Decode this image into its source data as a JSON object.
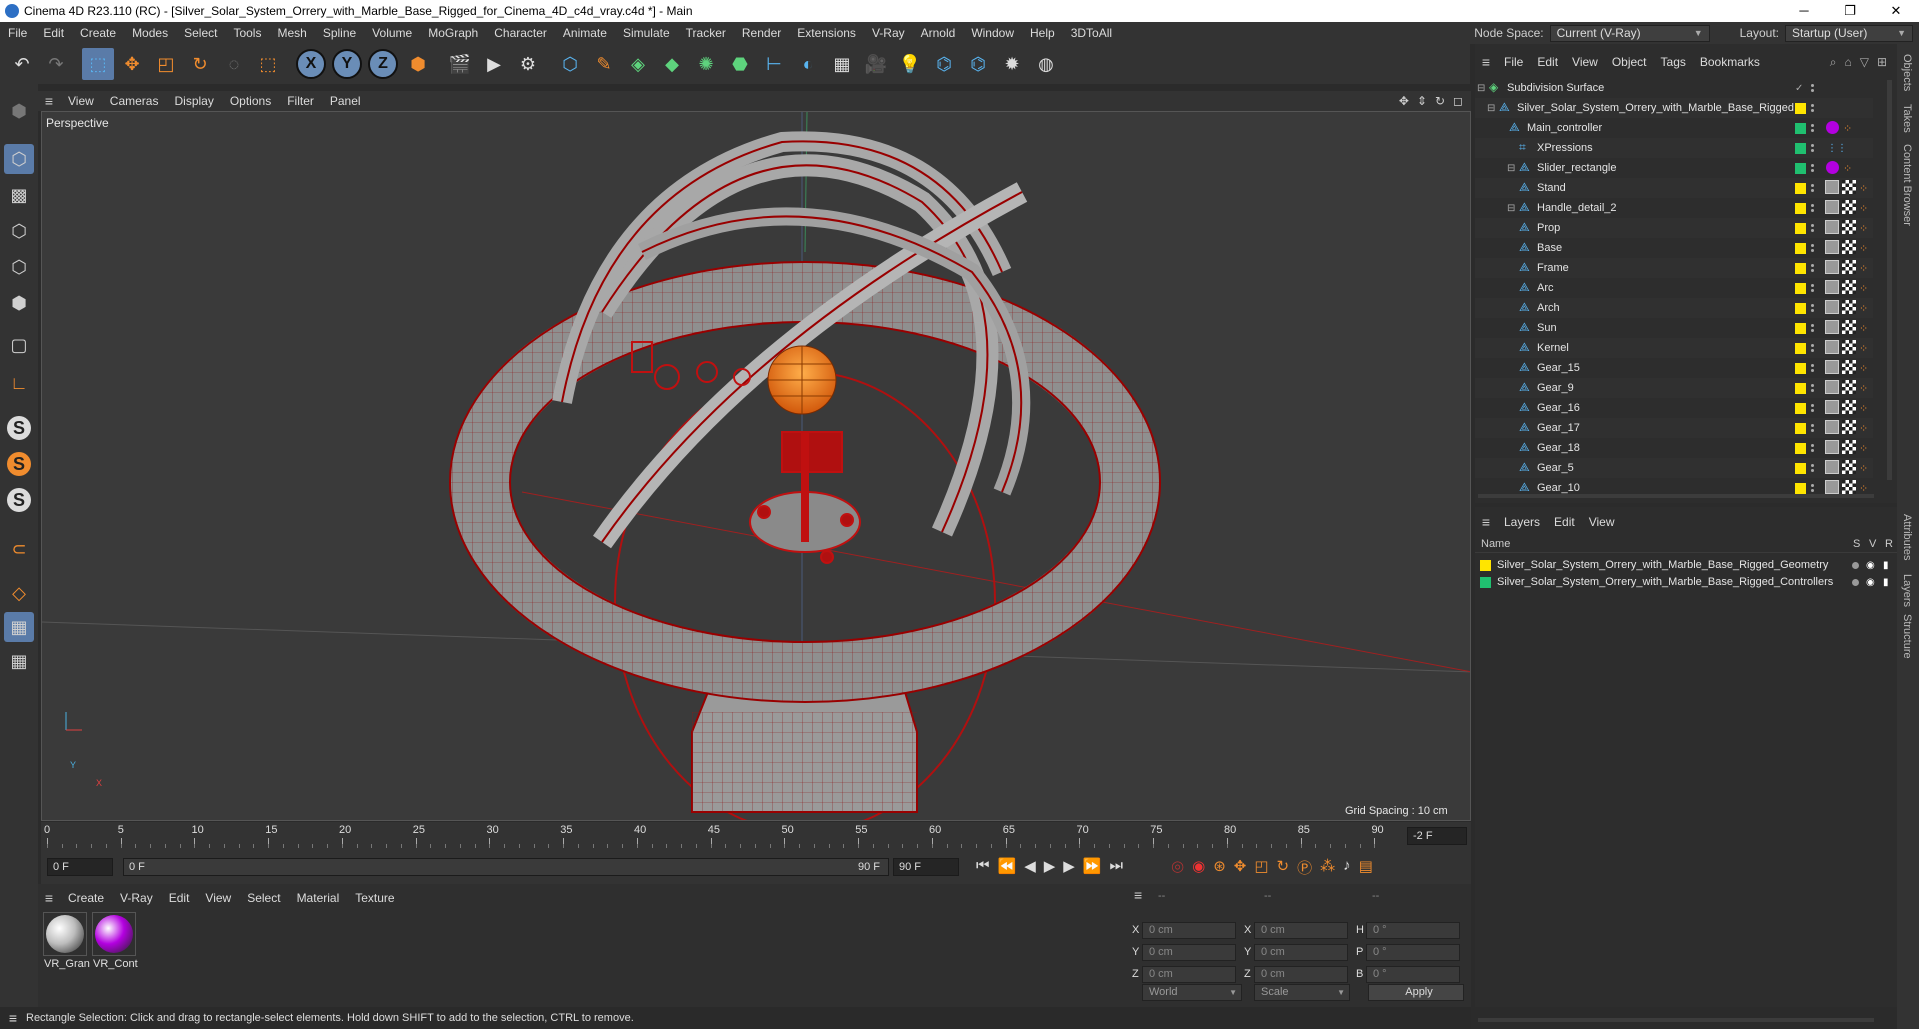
{
  "window": {
    "title": "Cinema 4D R23.110 (RC) - [Silver_Solar_System_Orrery_with_Marble_Base_Rigged_for_Cinema_4D_c4d_vray.c4d *] - Main",
    "minimize": "─",
    "maximize": "❐",
    "close": "✕"
  },
  "menu": [
    "File",
    "Edit",
    "Create",
    "Modes",
    "Select",
    "Tools",
    "Mesh",
    "Spline",
    "Volume",
    "MoGraph",
    "Character",
    "Animate",
    "Simulate",
    "Tracker",
    "Render",
    "Extensions",
    "V-Ray",
    "Arnold",
    "Window",
    "Help",
    "3DToAll"
  ],
  "nodespace": {
    "label": "Node Space:",
    "value": "Current (V-Ray)"
  },
  "layout": {
    "label": "Layout:",
    "value": "Startup (User)"
  },
  "viewport": {
    "menu": [
      "View",
      "Cameras",
      "Display",
      "Options",
      "Filter",
      "Panel"
    ],
    "label": "Perspective",
    "grid_spacing": "Grid Spacing : 10 cm",
    "axis_x": "X",
    "axis_y": "Y"
  },
  "timeline": {
    "ticks": [
      "0",
      "5",
      "10",
      "15",
      "20",
      "25",
      "30",
      "35",
      "40",
      "45",
      "50",
      "55",
      "60",
      "65",
      "70",
      "75",
      "80",
      "85",
      "90"
    ],
    "current_frame_field": "-2 F",
    "start": "0 F",
    "scrub": "0 F",
    "end_inner": "90 F",
    "end": "90 F"
  },
  "material_manager": {
    "menu": [
      "Create",
      "V-Ray",
      "Edit",
      "View",
      "Select",
      "Material",
      "Texture"
    ],
    "materials": [
      {
        "name": "VR_Gran",
        "color": "#bdbdbd"
      },
      {
        "name": "VR_Cont",
        "color": "#b300e0"
      }
    ]
  },
  "coords": {
    "header": [
      "--",
      "--",
      "--"
    ],
    "rows": [
      {
        "a": "X",
        "av": "0 cm",
        "b": "X",
        "bv": "0 cm",
        "c": "H",
        "cv": "0 °"
      },
      {
        "a": "Y",
        "av": "0 cm",
        "b": "Y",
        "bv": "0 cm",
        "c": "P",
        "cv": "0 °"
      },
      {
        "a": "Z",
        "av": "0 cm",
        "b": "Z",
        "bv": "0 cm",
        "c": "B",
        "cv": "0 °"
      }
    ],
    "world": "World",
    "scale": "Scale",
    "apply": "Apply"
  },
  "status": "Rectangle Selection: Click and drag to rectangle-select elements. Hold down SHIFT to add to the selection, CTRL to remove.",
  "objects": {
    "menu": [
      "File",
      "Edit",
      "View",
      "Object",
      "Tags",
      "Bookmarks"
    ],
    "items": [
      {
        "name": "Subdivision Surface",
        "indent": 0,
        "color": "#bbbbbb",
        "tag": "none"
      },
      {
        "name": "Silver_Solar_System_Orrery_with_Marble_Base_Rigged",
        "indent": 1,
        "color": "#ffe500",
        "tag": "none"
      },
      {
        "name": "Main_controller",
        "indent": 2,
        "color": "#20c070",
        "tag": "purple"
      },
      {
        "name": "XPressions",
        "indent": 3,
        "color": "#20c070",
        "tag": "xp"
      },
      {
        "name": "Slider_rectangle",
        "indent": 3,
        "color": "#20c070",
        "tag": "purple"
      },
      {
        "name": "Stand",
        "indent": 3,
        "color": "#ffe500",
        "tag": "tex"
      },
      {
        "name": "Handle_detail_2",
        "indent": 3,
        "color": "#ffe500",
        "tag": "tex"
      },
      {
        "name": "Prop",
        "indent": 3,
        "color": "#ffe500",
        "tag": "tex"
      },
      {
        "name": "Base",
        "indent": 3,
        "color": "#ffe500",
        "tag": "tex"
      },
      {
        "name": "Frame",
        "indent": 3,
        "color": "#ffe500",
        "tag": "tex"
      },
      {
        "name": "Arc",
        "indent": 3,
        "color": "#ffe500",
        "tag": "tex"
      },
      {
        "name": "Arch",
        "indent": 3,
        "color": "#ffe500",
        "tag": "tex"
      },
      {
        "name": "Sun",
        "indent": 3,
        "color": "#ffe500",
        "tag": "tex"
      },
      {
        "name": "Kernel",
        "indent": 3,
        "color": "#ffe500",
        "tag": "tex"
      },
      {
        "name": "Gear_15",
        "indent": 3,
        "color": "#ffe500",
        "tag": "tex"
      },
      {
        "name": "Gear_9",
        "indent": 3,
        "color": "#ffe500",
        "tag": "tex"
      },
      {
        "name": "Gear_16",
        "indent": 3,
        "color": "#ffe500",
        "tag": "tex"
      },
      {
        "name": "Gear_17",
        "indent": 3,
        "color": "#ffe500",
        "tag": "tex"
      },
      {
        "name": "Gear_18",
        "indent": 3,
        "color": "#ffe500",
        "tag": "tex"
      },
      {
        "name": "Gear_5",
        "indent": 3,
        "color": "#ffe500",
        "tag": "tex"
      },
      {
        "name": "Gear_10",
        "indent": 3,
        "color": "#ffe500",
        "tag": "tex"
      }
    ]
  },
  "layers": {
    "menu": [
      "Layers",
      "Edit",
      "View"
    ],
    "header": {
      "name": "Name",
      "s": "S",
      "v": "V",
      "r": "R"
    },
    "items": [
      {
        "name": "Silver_Solar_System_Orrery_with_Marble_Base_Rigged_Geometry",
        "color": "#ffe500"
      },
      {
        "name": "Silver_Solar_System_Orrery_with_Marble_Base_Rigged_Controllers",
        "color": "#20c070"
      }
    ]
  },
  "side_tabs": [
    "Objects",
    "Takes",
    "Content Browser",
    "Attributes",
    "Layers",
    "Structure"
  ]
}
